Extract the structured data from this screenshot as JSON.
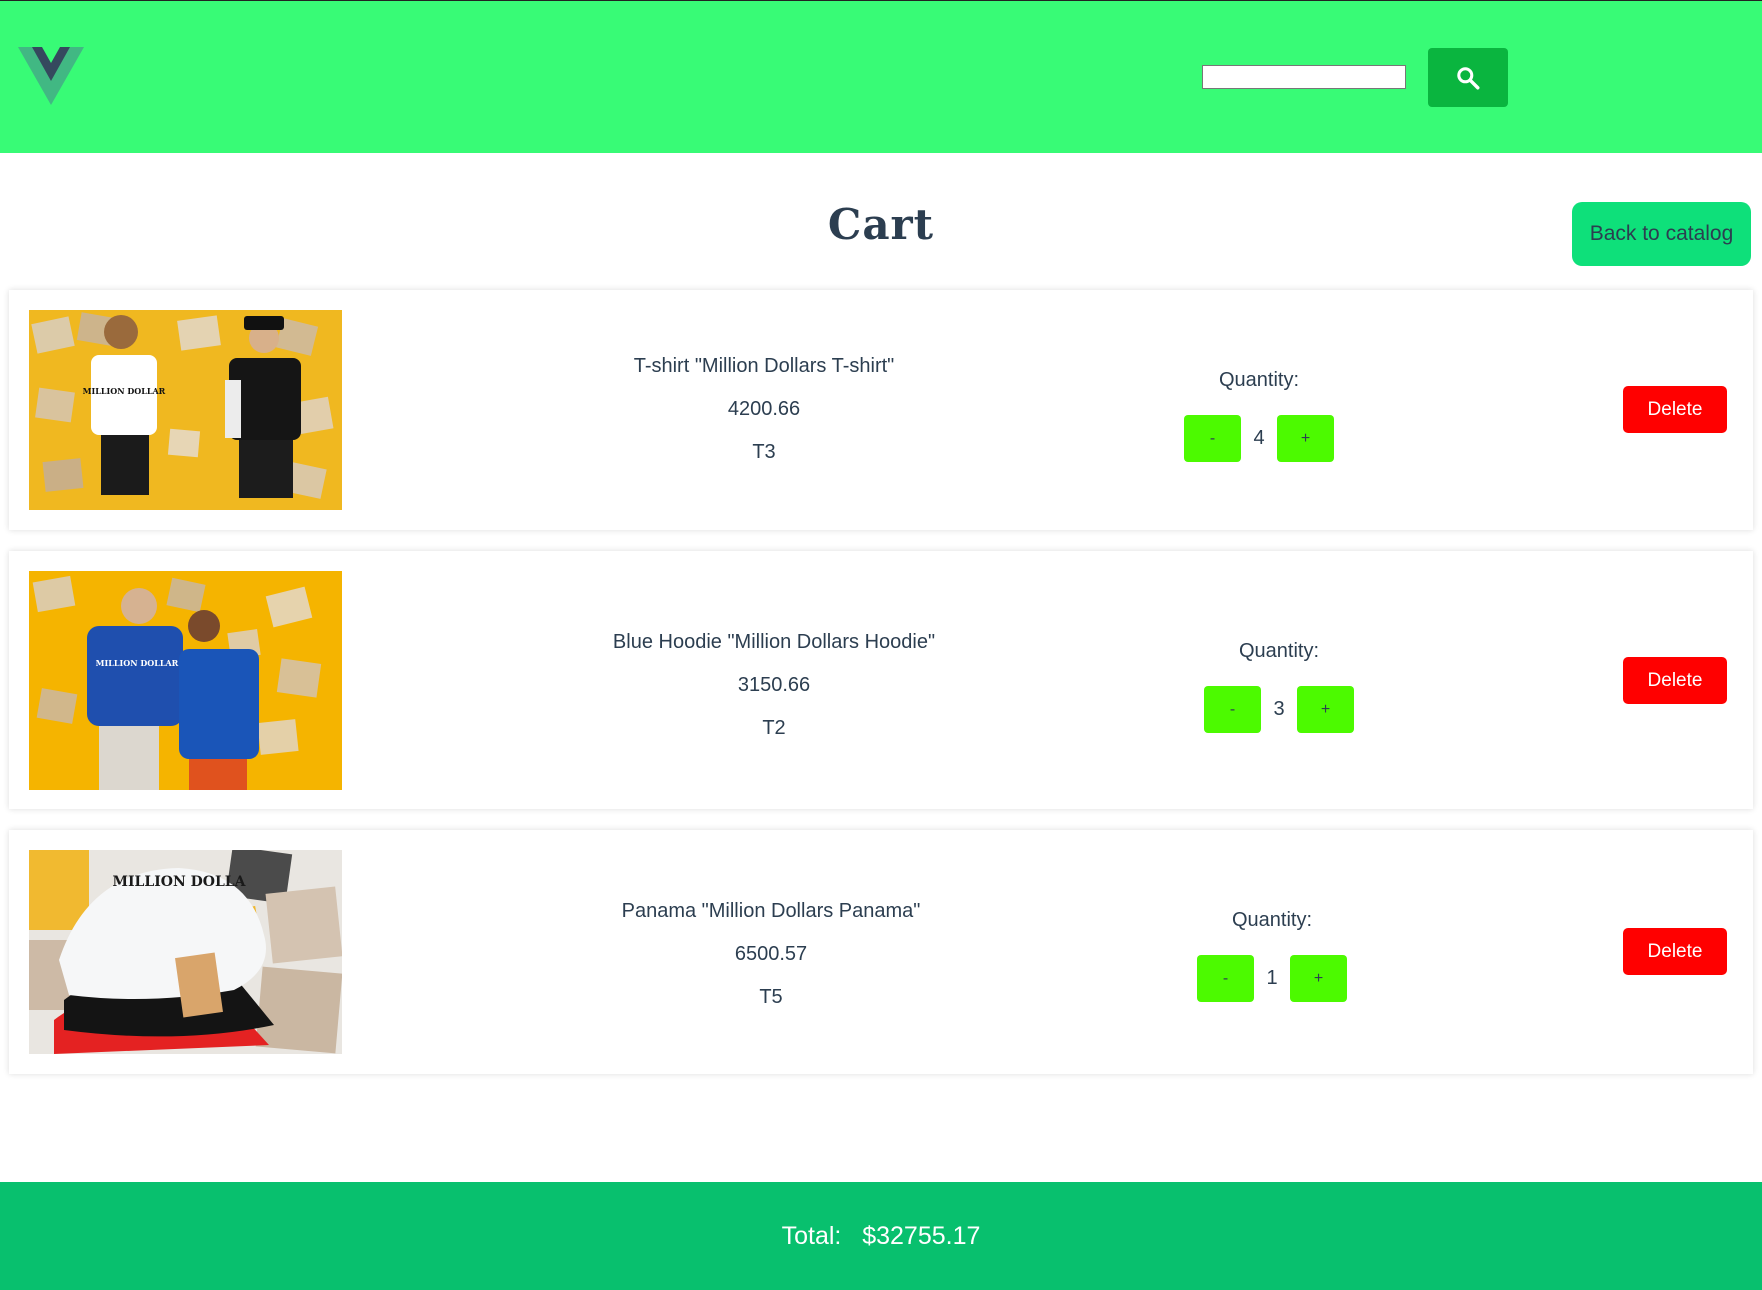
{
  "header": {
    "logo_icon": "vue-logo-icon",
    "search": {
      "value": "",
      "placeholder": ""
    },
    "search_icon": "search-icon"
  },
  "page": {
    "title": "Cart",
    "back_label": "Back to catalog"
  },
  "cart": {
    "items": [
      {
        "name": "T-shirt \"Million Dollars T-shirt\"",
        "price": "4200.66",
        "code": "T3",
        "quantity_label": "Quantity:",
        "quantity": "4",
        "minus": "-",
        "plus": "+",
        "delete_label": "Delete",
        "image_text": "MILLION DOLLAR"
      },
      {
        "name": "Blue Hoodie \"Million Dollars Hoodie\"",
        "price": "3150.66",
        "code": "T2",
        "quantity_label": "Quantity:",
        "quantity": "3",
        "minus": "-",
        "plus": "+",
        "delete_label": "Delete",
        "image_text": "MILLION DOLLAR"
      },
      {
        "name": "Panama \"Million Dollars Panama\"",
        "price": "6500.57",
        "code": "T5",
        "quantity_label": "Quantity:",
        "quantity": "1",
        "minus": "-",
        "plus": "+",
        "delete_label": "Delete",
        "image_text": "MILLION DOLLA"
      }
    ]
  },
  "footer": {
    "total_label": "Total:",
    "total_value": "$32755.17"
  },
  "colors": {
    "header_bg": "#38fb76",
    "search_button": "#0ab53f",
    "back_button": "#0ee07a",
    "qty_button": "#4cfa00",
    "delete_button": "#ff0000",
    "footer_bg": "#08c06e"
  }
}
